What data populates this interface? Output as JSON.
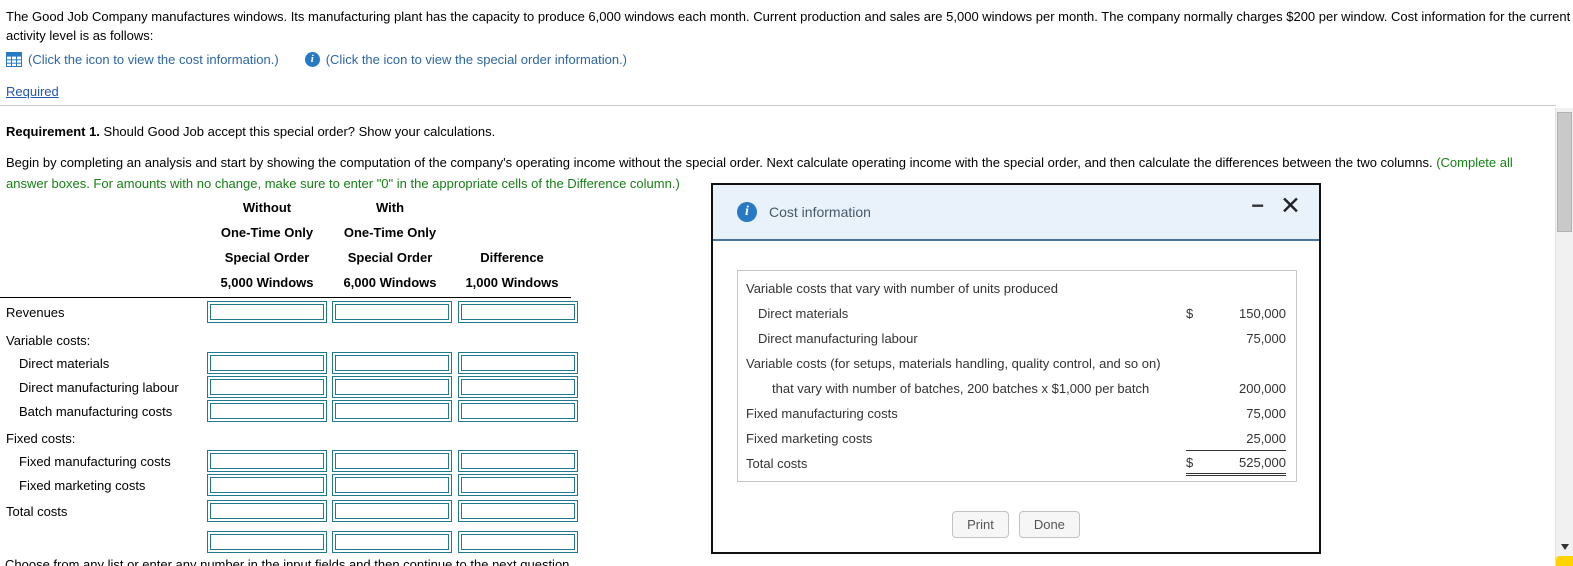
{
  "page": {
    "intro_line1": "The Good Job Company manufactures windows. Its manufacturing plant has the capacity to produce 6,000 windows each month. Current production and sales are 5,000 windows per month. The company normally charges $200 per window. Cost information for the current",
    "intro_line2": "activity level is as follows:",
    "cost_icon_label": "(Click the icon to view the cost information.)",
    "special_icon_label": "(Click the icon to view the special order information.)",
    "required_link": "Required",
    "requirement_title": "Requirement 1.",
    "requirement_text": " Should Good Job accept this special order? Show your calculations.",
    "instructions_black": "Begin by completing an analysis and start by showing the computation of the company's operating income without the special order. Next calculate operating income with the special order, and then calculate the differences between the two columns. ",
    "instructions_green_line1": "(Complete all",
    "instructions_green_line2": "answer boxes. For amounts with no change, make sure to enter \"0\" in the appropriate cells of the Difference column.)",
    "bottom_partial_text": "Choose from any list or enter any number in the input fields and then continue to the next question."
  },
  "worksheet": {
    "headers": {
      "col1": [
        "Without",
        "One-Time Only",
        "Special Order",
        "5,000 Windows"
      ],
      "col2": [
        "With",
        "One-Time Only",
        "Special Order",
        "6,000 Windows"
      ],
      "col3": [
        "",
        "",
        "Difference",
        "1,000 Windows"
      ]
    },
    "row_labels": {
      "revenues": "Revenues",
      "variable_costs": "Variable costs:",
      "direct_materials": "Direct materials",
      "direct_manufacturing_labour": "Direct manufacturing labour",
      "batch_manufacturing_costs": "Batch manufacturing costs",
      "fixed_costs": "Fixed costs:",
      "fixed_manufacturing_costs": "Fixed manufacturing costs",
      "fixed_marketing_costs": "Fixed marketing costs",
      "total_costs": "Total costs"
    }
  },
  "modal": {
    "title": "Cost information",
    "rows": [
      {
        "label": "Variable costs that vary with number of units produced",
        "currency": "",
        "amount": ""
      },
      {
        "label": "Direct materials",
        "currency": "$",
        "amount": "150,000"
      },
      {
        "label": "Direct manufacturing labour",
        "currency": "",
        "amount": "75,000"
      },
      {
        "label": "Variable costs (for setups, materials handling, quality control, and so on)",
        "currency": "",
        "amount": ""
      },
      {
        "label": "that vary with number of batches, 200 batches x $1,000 per batch",
        "currency": "",
        "amount": "200,000"
      },
      {
        "label": "Fixed manufacturing costs",
        "currency": "",
        "amount": "75,000"
      },
      {
        "label": "Fixed marketing costs",
        "currency": "",
        "amount": "25,000"
      },
      {
        "label": "Total costs",
        "currency": "$",
        "amount": "525,000"
      }
    ],
    "print_label": "Print",
    "done_label": "Done"
  },
  "icons": {
    "info_glyph": "i",
    "minimize_glyph": "−",
    "close_glyph": "✕"
  },
  "colors": {
    "accent_blue": "#2779c4",
    "link_blue": "#2456b0",
    "instruction_green": "#178017",
    "input_border_teal": "#20798f",
    "modal_header_bg": "#e9f2fb"
  }
}
